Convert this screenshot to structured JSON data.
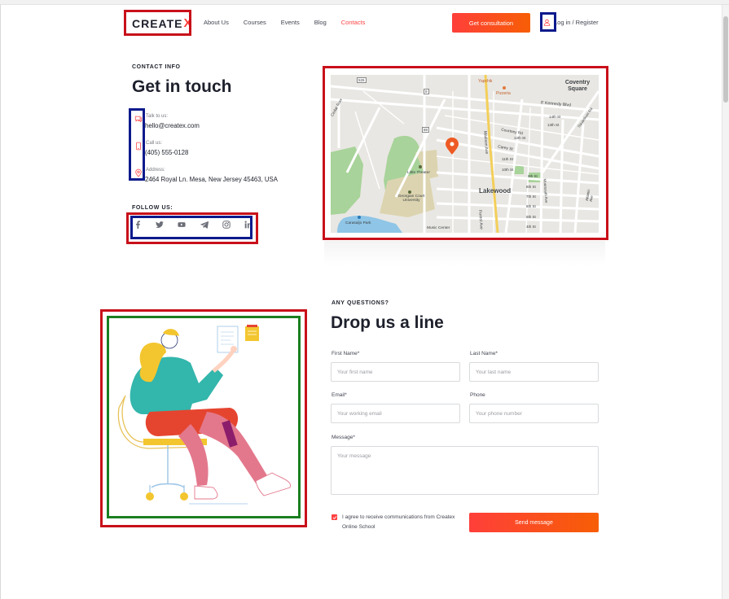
{
  "brand": {
    "name_main": "CREATE",
    "name_mark": "X"
  },
  "nav": {
    "items": [
      "About Us",
      "Courses",
      "Events",
      "Blog",
      "Contacts"
    ],
    "active": "Contacts"
  },
  "header": {
    "cta_label": "Get consultation",
    "login_label": "Log in / Register"
  },
  "contact": {
    "eyebrow": "CONTACT INFO",
    "title": "Get in touch",
    "email_label": "Talk to us:",
    "email": "hello@createx.com",
    "phone_label": "Call us:",
    "phone": "(405) 555-0128",
    "address_label": "Address:",
    "address": "2464 Royal Ln. Mesa, New Jersey 45463, USA",
    "follow_label": "FOLLOW US:"
  },
  "social_icons": [
    "facebook-icon",
    "twitter-icon",
    "youtube-icon",
    "telegram-icon",
    "instagram-icon",
    "linkedin-icon"
  ],
  "map": {
    "labels": {
      "coventry": "Coventry Square",
      "yapchik": "Yapchik",
      "pizzeria": "Pizzeria",
      "kennedy": "E Kennedy Blvd",
      "lakewood": "Lakewood",
      "little_theater": "Little Theater",
      "georgian": "Georgian Court University",
      "carasaljo": "Carasaljo Park",
      "music": "Music Center",
      "madison": "Madison Ave",
      "forest": "Forest Ave",
      "courtney": "Courtney Rd",
      "carey": "Carey St",
      "cedar": "Cedar Row",
      "route526": "526",
      "route9": "9",
      "st14": "14th St",
      "st13": "13th St",
      "st12": "12th St",
      "st11": "11th St",
      "st10": "10th St",
      "st9": "9th St",
      "st8": "8th St",
      "st7": "7th St",
      "st6": "6th St",
      "st5": "5th St",
      "st4": "4th St",
      "squankum": "Squankum Rd",
      "monmouth": "Monmouth Ave",
      "atlantic": "Atlantic Ave",
      "route88": "88"
    }
  },
  "form": {
    "eyebrow": "ANY QUESTIONS?",
    "title": "Drop us a line",
    "first_name_label": "First Name*",
    "first_name_placeholder": "Your first name",
    "last_name_label": "Last Name*",
    "last_name_placeholder": "Your last name",
    "email_label": "Email*",
    "email_placeholder": "Your working email",
    "phone_label": "Phone",
    "phone_placeholder": "Your phone number",
    "message_label": "Message*",
    "message_placeholder": "Your message",
    "agree_text": "I agree to receive communications from Createx Online School",
    "agree_checked": true,
    "submit_label": "Send message"
  },
  "colors": {
    "accent": "#ff4242",
    "annotation_red": "#c8101a",
    "annotation_blue": "#0b1a8c",
    "annotation_green": "#1a7f20"
  }
}
